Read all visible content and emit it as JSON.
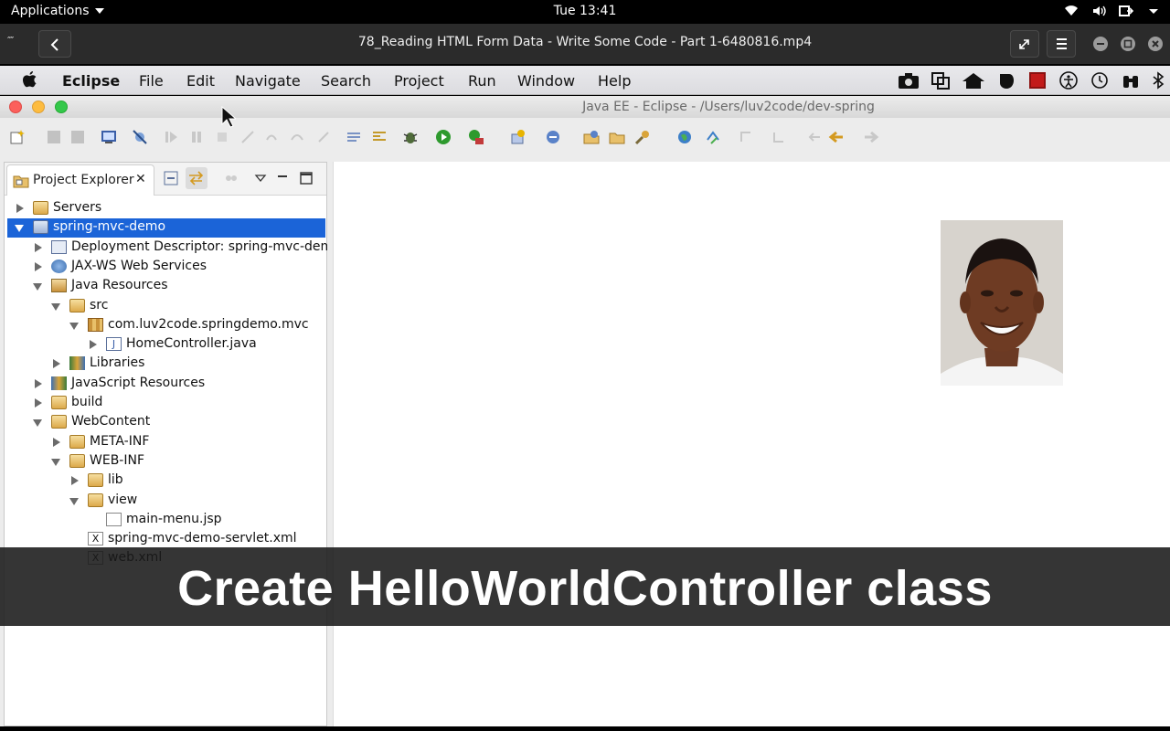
{
  "gnome_bar": {
    "applications_label": "Applications",
    "clock": "Tue 13:41",
    "tray_icons": [
      "wifi-icon",
      "volume-icon",
      "power-icon",
      "chevron-down-icon"
    ]
  },
  "player": {
    "title": "78_Reading HTML Form Data - Write Some Code - Part 1-6480816.mp4",
    "buttons": [
      "back-button",
      "fullscreen-button",
      "menu-button",
      "minimize-button",
      "maximize-button",
      "close-button"
    ]
  },
  "mac_menu": {
    "app_name": "Eclipse",
    "items": [
      "File",
      "Edit",
      "Navigate",
      "Search",
      "Project",
      "Run",
      "Window",
      "Help"
    ]
  },
  "eclipse": {
    "window_title": "Java EE - Eclipse - /Users/luv2code/dev-spring",
    "project_explorer": {
      "tab_label": "Project Explorer",
      "tree": [
        {
          "label": "Servers",
          "depth": 0,
          "state": "closed",
          "icon": "folder-icon"
        },
        {
          "label": "spring-mvc-demo",
          "depth": 0,
          "state": "open",
          "icon": "project-icon",
          "selected": true
        },
        {
          "label": "Deployment Descriptor: spring-mvc-demo",
          "depth": 1,
          "state": "closed",
          "icon": "descriptor-icon"
        },
        {
          "label": "JAX-WS Web Services",
          "depth": 1,
          "state": "closed",
          "icon": "webservice-icon"
        },
        {
          "label": "Java Resources",
          "depth": 1,
          "state": "open",
          "icon": "java-resources-icon"
        },
        {
          "label": "src",
          "depth": 2,
          "state": "open",
          "icon": "source-folder-icon"
        },
        {
          "label": "com.luv2code.springdemo.mvc",
          "depth": 3,
          "state": "open",
          "icon": "package-icon"
        },
        {
          "label": "HomeController.java",
          "depth": 4,
          "state": "closed",
          "icon": "java-file-icon"
        },
        {
          "label": "Libraries",
          "depth": 2,
          "state": "closed",
          "icon": "libraries-icon"
        },
        {
          "label": "JavaScript Resources",
          "depth": 1,
          "state": "closed",
          "icon": "js-resources-icon"
        },
        {
          "label": "build",
          "depth": 1,
          "state": "closed",
          "icon": "folder-icon"
        },
        {
          "label": "WebContent",
          "depth": 1,
          "state": "open",
          "icon": "folder-icon"
        },
        {
          "label": "META-INF",
          "depth": 2,
          "state": "closed",
          "icon": "folder-icon"
        },
        {
          "label": "WEB-INF",
          "depth": 2,
          "state": "open",
          "icon": "folder-icon"
        },
        {
          "label": "lib",
          "depth": 3,
          "state": "closed",
          "icon": "folder-icon"
        },
        {
          "label": "view",
          "depth": 3,
          "state": "open",
          "icon": "folder-icon"
        },
        {
          "label": "main-menu.jsp",
          "depth": 4,
          "state": "none",
          "icon": "jsp-file-icon"
        },
        {
          "label": "spring-mvc-demo-servlet.xml",
          "depth": 3,
          "state": "none",
          "icon": "xml-file-icon"
        },
        {
          "label": "web.xml",
          "depth": 3,
          "state": "none",
          "icon": "xml-file-icon"
        }
      ]
    }
  },
  "caption": "Create HelloWorldController class",
  "colors": {
    "selection": "#1b64d8",
    "caption_bg": "#191919",
    "traffic_red": "#fc605c",
    "traffic_yellow": "#fdbc40",
    "traffic_green": "#34c84a"
  }
}
